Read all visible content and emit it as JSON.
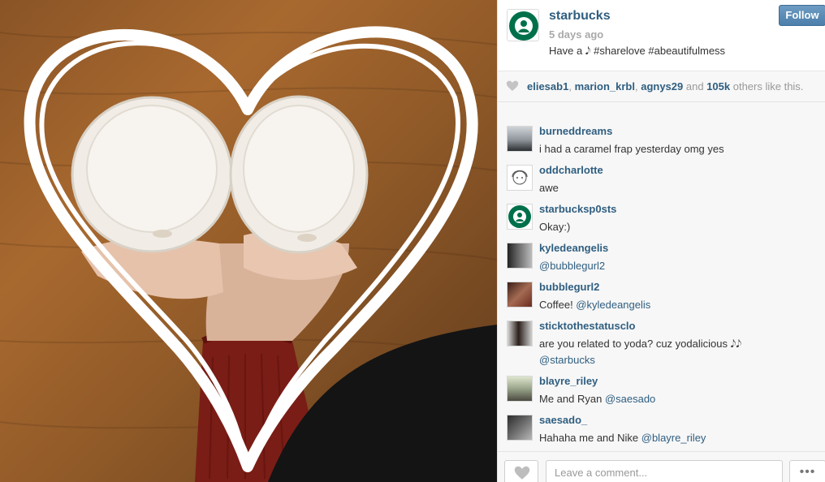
{
  "post": {
    "owner": "starbucks",
    "time": "5 days ago",
    "caption": "Have a 𝅘𝅥𝅮 #sharelove #abeautifulmess",
    "follow_label": "Follow"
  },
  "likes": {
    "users": [
      "eliesab1",
      "marion_krbl",
      "agnys29"
    ],
    "sep1": ", ",
    "sep2": ", ",
    "and_text": " and ",
    "count": "105k",
    "suffix": " others like this."
  },
  "comments": [
    {
      "user": "burneddreams",
      "text": "i had a caramel frap yesterday omg yes"
    },
    {
      "user": "oddcharlotte",
      "text": "awe"
    },
    {
      "user": "starbucksp0sts",
      "text": "Okay:)"
    },
    {
      "user": "kyledeangelis",
      "mention": "@bubblegurl2"
    },
    {
      "user": "bubblegurl2",
      "text": "Coffee! ",
      "mention": "@kyledeangelis"
    },
    {
      "user": "sticktothestatusclo",
      "text": "are you related to yoda? cuz yodalicious 𝅘𝅥𝅮𝅘𝅥𝅮",
      "mention": "@starbucks"
    },
    {
      "user": "blayre_riley",
      "text": "Me and Ryan ",
      "mention": "@saesado"
    },
    {
      "user": "saesado_",
      "text": "Hahaha me and Nike ",
      "mention": "@blayre_riley"
    }
  ],
  "footer": {
    "comment_placeholder": "Leave a comment...",
    "more_label": "•••"
  },
  "colors": {
    "link": "#2f5e80",
    "follow_button": "#5a8bb8",
    "starbucks_green": "#00704a"
  },
  "icons": [
    "heart-icon",
    "ellipsis-icon",
    "starbucks-logo"
  ]
}
